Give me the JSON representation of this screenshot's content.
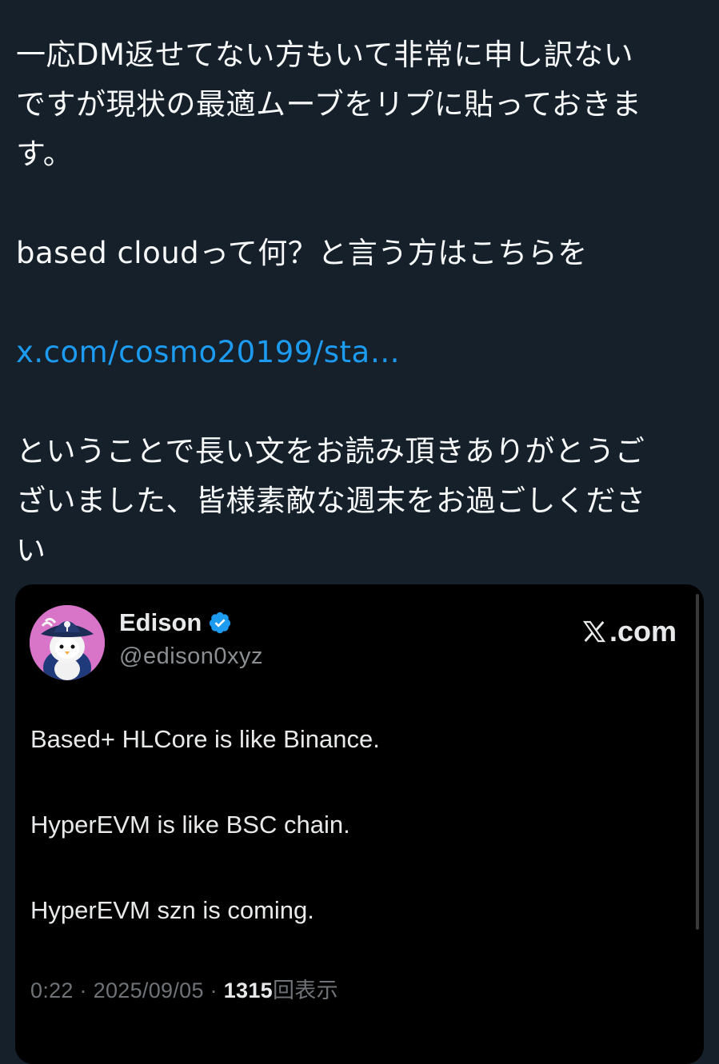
{
  "tweet": {
    "line1": "一応DM返せてない方もいて非常に申し訳ない",
    "line2": "ですが現状の最適ムーブをリプに貼っておきま",
    "line3": "す。",
    "line4": "based cloudって何？と言う方はこちらを",
    "link_text": "x.com/cosmo20199/sta…",
    "line5": "ということで長い文をお読み頂きありがとうご",
    "line6": "ざいました、皆様素敵な週末をお過ごしくださ",
    "line7": "い"
  },
  "embed": {
    "author_name": "Edison",
    "author_handle": "@edison0xyz",
    "site_label": ".com",
    "lines": [
      "Based+ HLCore is like Binance.",
      "HyperEVM is like BSC chain.",
      "HyperEVM szn is coming."
    ],
    "time": "0:22",
    "separator": " · ",
    "date": "2025/09/05",
    "views_count": "1315",
    "views_label": "回表示"
  },
  "icons": {
    "verified": "verified-badge-icon",
    "x_logo": "x-logo-icon"
  },
  "colors": {
    "background": "#15202b",
    "text": "#f7f9f9",
    "link": "#1d9bf0",
    "card_background": "#000000",
    "verified_blue": "#1d9bf0",
    "avatar_background": "#d875c8"
  }
}
